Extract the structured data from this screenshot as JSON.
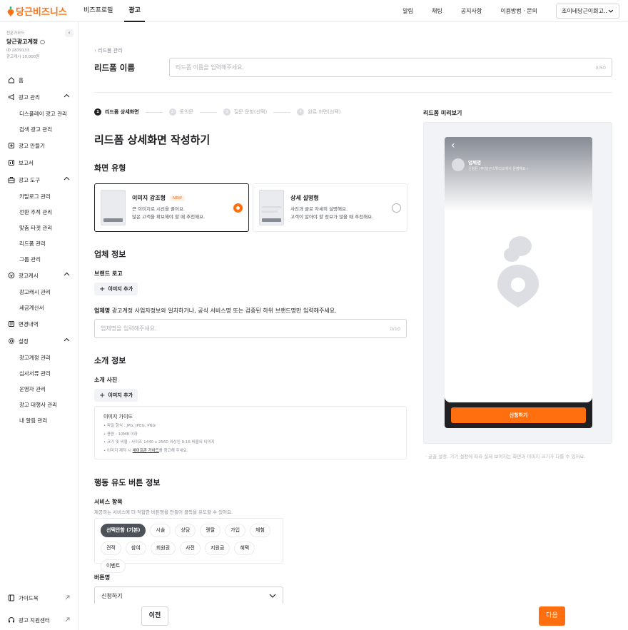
{
  "brand": {
    "name": "당근비즈니스",
    "color": "#ff6f0f"
  },
  "topnav": [
    {
      "label": "비즈프로필",
      "active": false
    },
    {
      "label": "광고",
      "active": true
    }
  ],
  "topright": {
    "links": [
      "알림",
      "채팅",
      "공지사항",
      "이용방법 · 문의"
    ],
    "account_select": "조이네당근이회고..."
  },
  "account": {
    "tag": "전문가모드",
    "name": "당근광고계정 ○",
    "id": "ID 2879133",
    "balance": "광고캐시 10,000원"
  },
  "sidebar": {
    "collapse_icon": "‹",
    "items": [
      {
        "label": "홈",
        "type": "top",
        "icon": "home-icon"
      },
      {
        "label": "광고 관리",
        "type": "top",
        "icon": "megaphone-icon",
        "expanded": true
      },
      {
        "label": "디스플레이 광고 관리",
        "type": "sub"
      },
      {
        "label": "검색 광고 관리",
        "type": "sub"
      },
      {
        "label": "광고 만들기",
        "type": "top",
        "icon": "plus-square-icon"
      },
      {
        "label": "보고서",
        "type": "top",
        "icon": "report-icon"
      },
      {
        "label": "광고 도구",
        "type": "top",
        "icon": "toolbox-icon",
        "expanded": true
      },
      {
        "label": "카탈로그 관리",
        "type": "sub"
      },
      {
        "label": "전환 추적 관리",
        "type": "sub"
      },
      {
        "label": "맞춤 타겟 관리",
        "type": "sub"
      },
      {
        "label": "리드폼 관리",
        "type": "sub"
      },
      {
        "label": "그룹 관리",
        "type": "sub"
      },
      {
        "label": "광고캐시",
        "type": "top",
        "icon": "coin-icon",
        "expanded": true
      },
      {
        "label": "광고캐시 관리",
        "type": "sub"
      },
      {
        "label": "세금계산서",
        "type": "sub"
      },
      {
        "label": "변경내역",
        "type": "top",
        "icon": "history-icon"
      },
      {
        "label": "설정",
        "type": "top",
        "icon": "gear-icon",
        "expanded": true
      },
      {
        "label": "광고계정 관리",
        "type": "sub"
      },
      {
        "label": "심사서류 관리",
        "type": "sub"
      },
      {
        "label": "운영자 관리",
        "type": "sub"
      },
      {
        "label": "광고 대행사 관리",
        "type": "sub"
      },
      {
        "label": "내 알림 관리",
        "type": "sub"
      }
    ],
    "bottom": [
      {
        "label": "가이드북",
        "icon": "book-icon"
      },
      {
        "label": "광고 지원센터",
        "icon": "headset-icon"
      }
    ]
  },
  "main": {
    "breadcrumb": "‹  리드폼 관리",
    "name_label": "리드폼 이름",
    "name_placeholder": "리드폼 이름을 입력해주세요.",
    "name_count": "0/50",
    "steps": [
      {
        "num": "1",
        "label": "리드폼 상세화면",
        "active": true
      },
      {
        "num": "2",
        "label": "동의문",
        "active": false
      },
      {
        "num": "3",
        "label": "질문 문항(선택)",
        "active": false
      },
      {
        "num": "4",
        "label": "완료 화면(선택)",
        "active": false
      }
    ],
    "heading": "리드폼 상세화면 작성하기",
    "screen_type": {
      "title": "화면 유형",
      "options": [
        {
          "title": "이미지 강조형",
          "badge": "NEW",
          "desc1": "큰 이미지로 시선을 끌어요.",
          "desc2": "많은 고객을 확보해야 할 때 추천해요.",
          "selected": true
        },
        {
          "title": "상세 설명형",
          "badge": "",
          "desc1": "사진과 글로 자세히 설명해요.",
          "desc2": "고객이 알아야 할 정보가 많을 때 추천해요.",
          "selected": false
        }
      ]
    },
    "business": {
      "title": "업체 정보",
      "logo_label": "브랜드 로고",
      "add_image": "이미지 추가",
      "name_help_bold": "업체명",
      "name_help": " 광고계정 사업자정보와 일치하거나, 공식 서비스명 또는 검증된 하위 브랜드명만 입력해주세요.",
      "name_placeholder": "업체명을 입력해주세요.",
      "name_count": "0/10"
    },
    "intro": {
      "title": "소개 정보",
      "photo_label": "소개 사진",
      "add_image": "이미지 추가",
      "guide_title": "이미지 가이드",
      "guide": [
        "파일 형식 : JPG, JPEG, PNG",
        "용량 : 10MB 이하",
        "크기 및 비율 : 사이즈 1440 x 2560 이상인 9:16 비율의 이미지"
      ],
      "guide_last_pre": "이미지 제작 시 ",
      "guide_link": "세이프존 가이드",
      "guide_last_post": "를 참고해 주세요."
    },
    "cta": {
      "title": "행동 유도 버튼 정보",
      "service_label": "서비스 항목",
      "service_desc": "제공하는 서비스에 더 적합한 버튼명을 만들어 클릭을 유도할 수 있어요.",
      "chips": [
        {
          "label": "선택안함 (기본)",
          "on": true
        },
        {
          "label": "시술",
          "on": false
        },
        {
          "label": "상담",
          "on": false
        },
        {
          "label": "렌탈",
          "on": false
        },
        {
          "label": "가입",
          "on": false
        },
        {
          "label": "체험",
          "on": false
        },
        {
          "label": "견적",
          "on": false
        },
        {
          "label": "참여",
          "on": false
        },
        {
          "label": "회원권",
          "on": false
        },
        {
          "label": "사전",
          "on": false
        },
        {
          "label": "지원금",
          "on": false
        },
        {
          "label": "혜택",
          "on": false
        },
        {
          "label": "이벤트",
          "on": false
        }
      ],
      "button_label": "버튼명",
      "button_value": "신청하기"
    }
  },
  "preview": {
    "label": "리드폼 미리보기",
    "business_name": "업체명",
    "business_sub": "신청은 (주)당근스튜디오에서 운영해요 ›",
    "cta": "신청하기",
    "note": "·  글꼴 설정, 기기 설정에 따라 실제 보여지는 화면과 이미지 크기가 다를 수 있어요."
  },
  "footer": {
    "prev": "이전",
    "next": "다음"
  }
}
